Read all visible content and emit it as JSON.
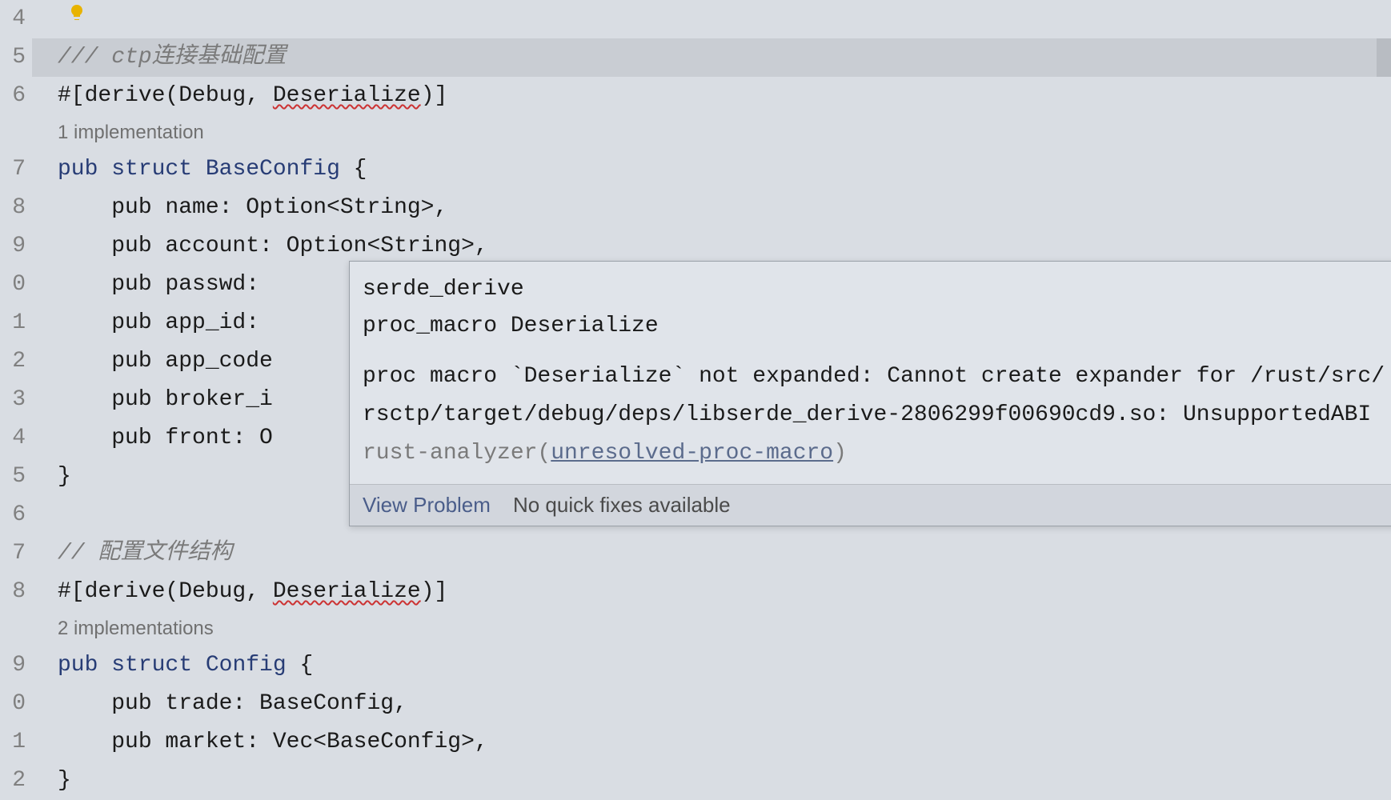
{
  "gutter": {
    "lines": [
      "4",
      "5",
      "6",
      "7",
      "8",
      "9",
      "0",
      "1",
      "2",
      "3",
      "4",
      "5",
      "6",
      "7",
      "8",
      "9",
      "0",
      "1",
      "2"
    ]
  },
  "code": {
    "l25_comment": "/// ctp连接基础配置",
    "l26_derive_pre": "#[derive(Debug, ",
    "l26_deserialize": "Deserialize",
    "l26_derive_post": ")]",
    "l26a_codelens": "1 implementation",
    "l27_struct_pre": "pub struct ",
    "l27_struct_name": "BaseConfig",
    "l27_struct_post": " {",
    "l28": "    pub name: Option<String>,",
    "l29": "    pub account: Option<String>,",
    "l30": "    pub passwd: ",
    "l31": "    pub app_id: ",
    "l32": "    pub app_code",
    "l33": "    pub broker_i",
    "l34": "    pub front: O",
    "l35": "}",
    "l37_comment": "// 配置文件结构",
    "l38_derive_pre": "#[derive(Debug, ",
    "l38_deserialize": "Deserialize",
    "l38_derive_post": ")]",
    "l38a_codelens": "2 implementations",
    "l39_struct_pre": "pub struct ",
    "l39_struct_name": "Config",
    "l39_struct_post": " {",
    "l40": "    pub trade: BaseConfig,",
    "l41": "    pub market: Vec<BaseConfig>,",
    "l42": "}"
  },
  "popup": {
    "crate": "serde_derive",
    "kind": "proc_macro Deserialize",
    "msg_pre": "proc macro `Deserialize` not expanded: Cannot create expander for /rust/src/rsctp/target/debug/deps/libserde_derive-2806299f00690cd9.so: UnsupportedABI ",
    "source": "rust-analyzer(",
    "link": "unresolved-proc-macro",
    "tail": ")",
    "view_problem": "View Problem",
    "no_fixes": "No quick fixes available"
  }
}
